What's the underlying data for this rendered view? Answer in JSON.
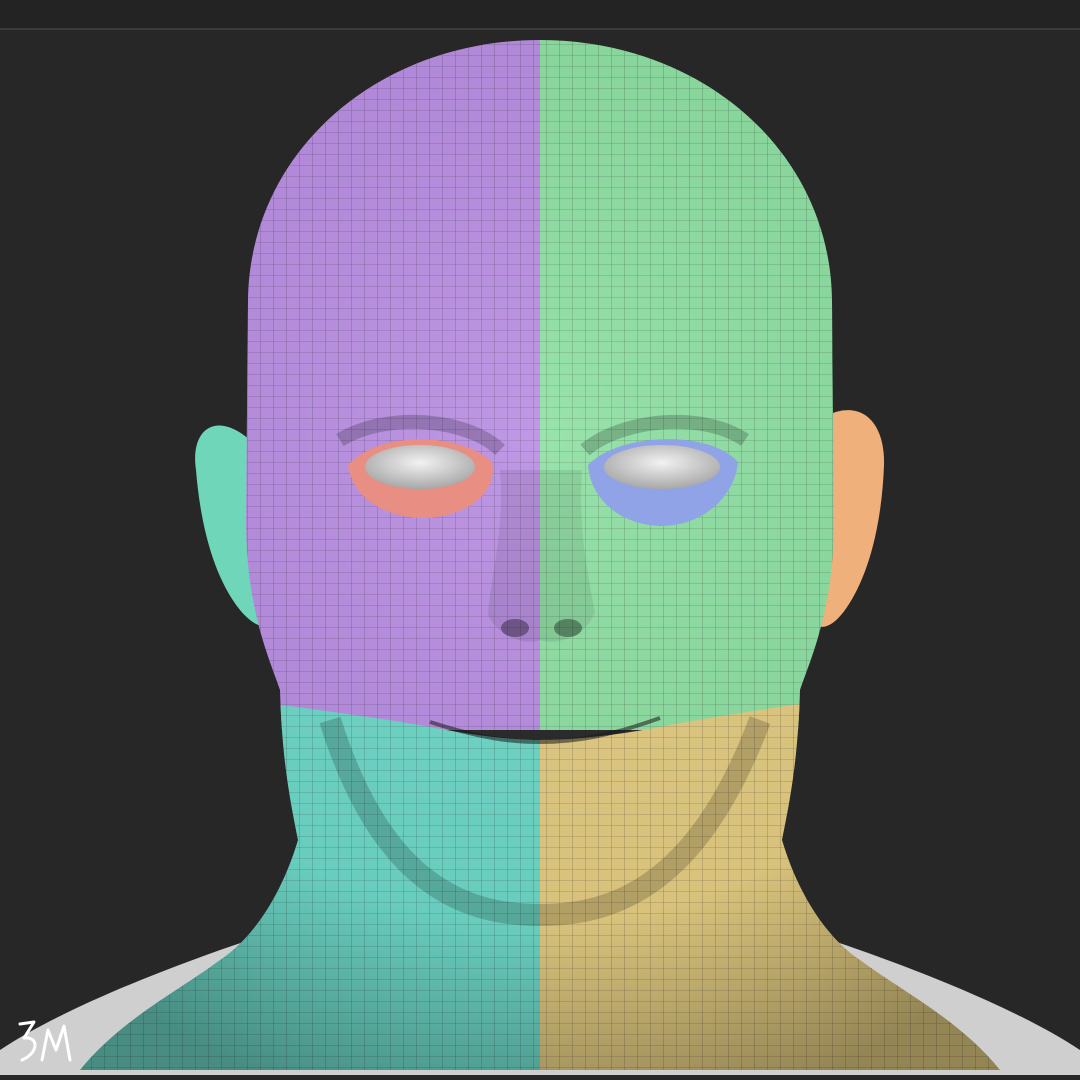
{
  "viewport": {
    "background": "#272727",
    "top_bar_color": "#232323"
  },
  "mesh": {
    "view": "front",
    "wireframe_visible": true,
    "polygroups": [
      {
        "name": "scalp-left",
        "color": "#b98ee3"
      },
      {
        "name": "scalp-right",
        "color": "#8ee0a3"
      },
      {
        "name": "jaw-left",
        "color": "#6ed8c8"
      },
      {
        "name": "jaw-right",
        "color": "#e3cc82"
      },
      {
        "name": "ear-left",
        "color": "#6fd6b9"
      },
      {
        "name": "ear-right",
        "color": "#f0b07c"
      },
      {
        "name": "eyelid-left",
        "color": "#e88e82"
      },
      {
        "name": "eyelid-right",
        "color": "#8fa3e6"
      },
      {
        "name": "eyeballs",
        "color": "#d9d9d9"
      },
      {
        "name": "shoulders",
        "color": "#cfcfcf"
      }
    ]
  },
  "signature": {
    "text": "BM",
    "color": "#ffffff"
  }
}
